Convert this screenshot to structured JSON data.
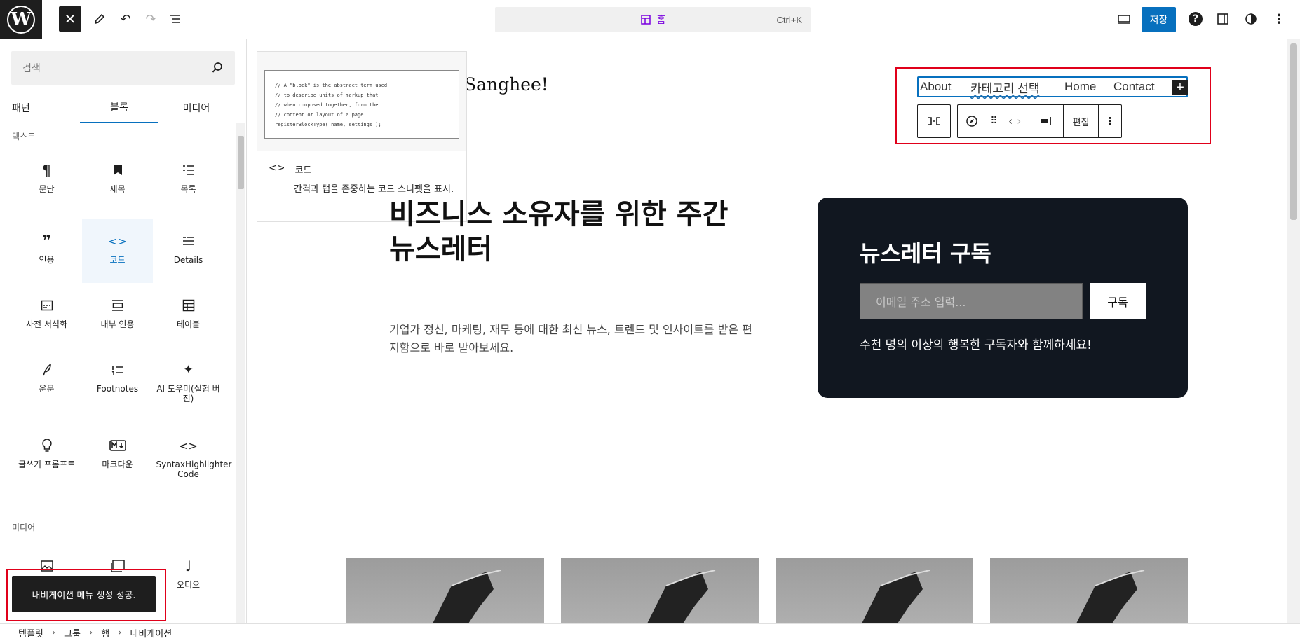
{
  "topbar": {
    "page_title": "홈",
    "shortcut": "Ctrl+K",
    "save_label": "저장"
  },
  "sidebar": {
    "search_placeholder": "검색",
    "tabs": [
      "패턴",
      "블록",
      "미디어"
    ],
    "categories": {
      "text": "텍스트",
      "media": "미디어"
    },
    "blocks": [
      {
        "label": "문단",
        "icon": "paragraph-icon"
      },
      {
        "label": "제목",
        "icon": "heading-icon"
      },
      {
        "label": "목록",
        "icon": "list-icon"
      },
      {
        "label": "인용",
        "icon": "quote-icon"
      },
      {
        "label": "코드",
        "icon": "code-icon"
      },
      {
        "label": "Details",
        "icon": "details-icon"
      },
      {
        "label": "사전 서식화",
        "icon": "preformatted-icon"
      },
      {
        "label": "내부 인용",
        "icon": "pullquote-icon"
      },
      {
        "label": "테이블",
        "icon": "table-icon"
      },
      {
        "label": "운문",
        "icon": "verse-icon"
      },
      {
        "label": "Footnotes",
        "icon": "footnotes-icon"
      },
      {
        "label": "AI 도우미(실험 버전)",
        "icon": "ai-sparkle-icon"
      },
      {
        "label": "글쓰기 프롬프트",
        "icon": "lightbulb-icon"
      },
      {
        "label": "마크다운",
        "icon": "markdown-icon"
      },
      {
        "label": "SyntaxHighlighter Code",
        "icon": "code-icon"
      }
    ],
    "media_blocks": [
      {
        "label": "",
        "icon": "image-icon"
      },
      {
        "label": "",
        "icon": "gallery-icon"
      },
      {
        "label": "오디오",
        "icon": "audio-icon"
      }
    ]
  },
  "snackbar": "내비게이션 메뉴 생성 성공.",
  "preview": {
    "code_lines": [
      "// A \"block\" is the abstract term used",
      "// to describe units of markup that",
      "// when composed together, form the",
      "// content or layout of a page.",
      "registerBlockType( name, settings );"
    ],
    "block_name": "코드",
    "block_desc": "간격과 탭을 존중하는 코드 스니펫을 표시."
  },
  "canvas": {
    "site_title": "Sanghee!",
    "nav_items": [
      "About",
      "카테고리 선택",
      "Home",
      "Contact"
    ],
    "toolbar_edit": "편집",
    "hero_heading": "비즈니스 소유자를 위한 주간 뉴스레터",
    "hero_text": "기업가 정신, 마케팅, 재무 등에 대한 최신 뉴스, 트렌드 및 인사이트를 받은 편지함으로 바로 받아보세요.",
    "newsletter_title": "뉴스레터 구독",
    "email_placeholder": "이메일 주소 입력...",
    "subscribe_label": "구독",
    "newsletter_note": "수천 명의 이상의 행복한 구독자와 함께하세요!"
  },
  "breadcrumb": [
    "템플릿",
    "그룹",
    "행",
    "내비게이션"
  ]
}
